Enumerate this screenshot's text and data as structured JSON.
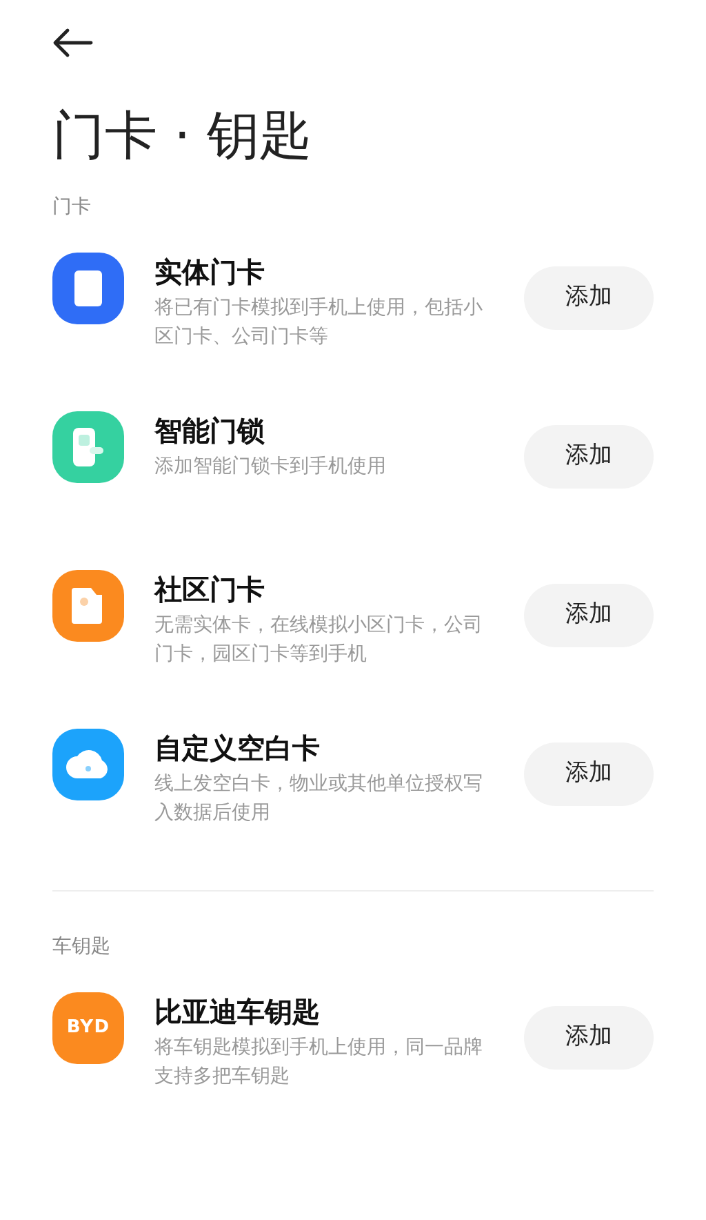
{
  "title": "门卡 · 钥匙",
  "sections": [
    {
      "heading": "门卡",
      "items": [
        {
          "kind": "card",
          "color": "#2f6df6",
          "name": "实体门卡",
          "description": "将已有门卡模拟到手机上使用，包括小区门卡、公司门卡等",
          "button": "添加"
        },
        {
          "kind": "lock",
          "color": "#35d1a0",
          "name": "智能门锁",
          "description": "添加智能门锁卡到手机使用",
          "button": "添加"
        },
        {
          "kind": "photo",
          "color": "#fb8a1f",
          "name": "社区门卡",
          "description": "无需实体卡，在线模拟小区门卡，公司门卡，园区门卡等到手机",
          "button": "添加"
        },
        {
          "kind": "cloud",
          "color": "#1ca3fb",
          "name": "自定义空白卡",
          "description": "线上发空白卡，物业或其他单位授权写入数据后使用",
          "button": "添加"
        }
      ]
    },
    {
      "heading": "车钥匙",
      "items": [
        {
          "kind": "logo",
          "color": "#fb8a1f",
          "logo_text": "BYD",
          "name": "比亚迪车钥匙",
          "description": "将车钥匙模拟到手机上使用，同一品牌支持多把车钥匙",
          "button": "添加"
        }
      ]
    }
  ]
}
